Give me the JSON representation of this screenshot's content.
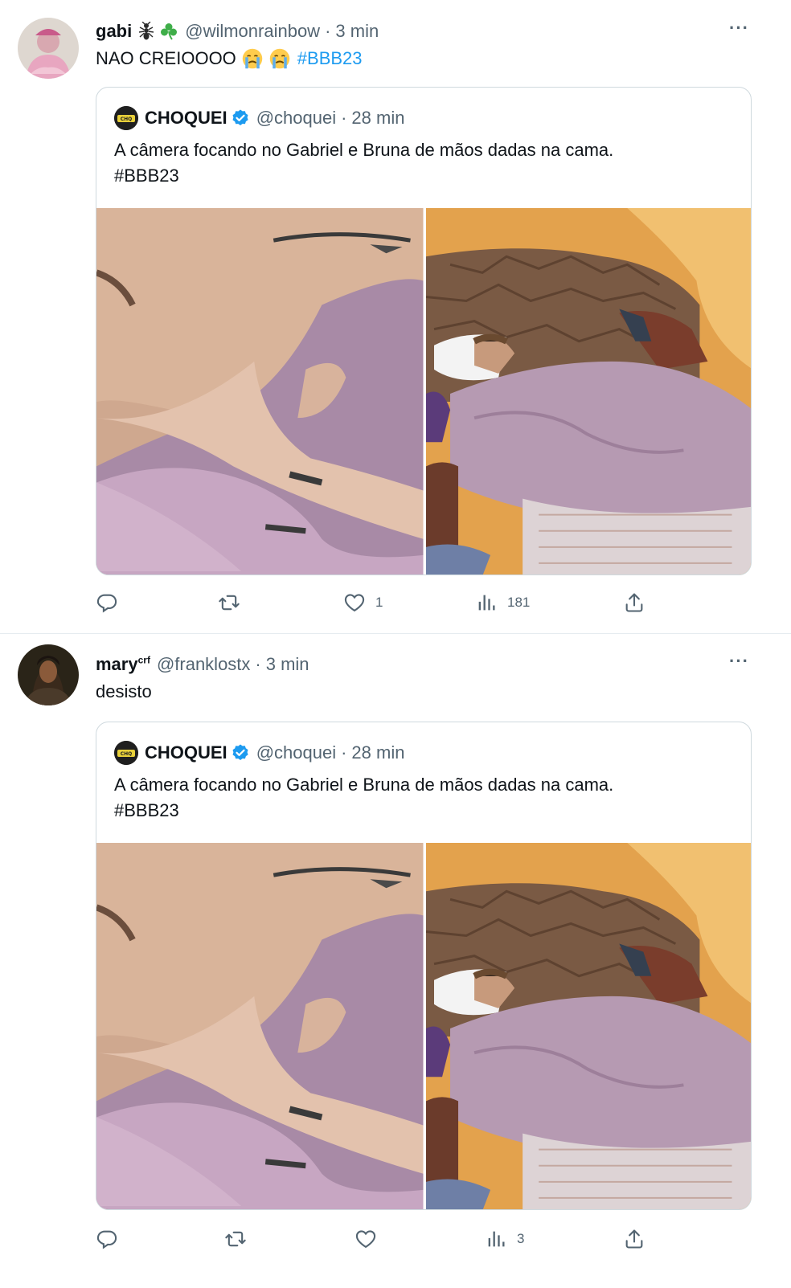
{
  "tweets": [
    {
      "display_name": "gabi",
      "name_emojis": [
        "ant-icon",
        "shamrock-icon"
      ],
      "handle": "@wilmonrainbow",
      "dot": "·",
      "time": "3 min",
      "more": "···",
      "text": "NAO CREIOOOO",
      "text_emojis": [
        "crying-emoji",
        "crying-emoji"
      ],
      "hashtag": "#BBB23",
      "quote": {
        "name": "CHOQUEI",
        "handle": "@choquei",
        "dot": "·",
        "time": "28 min",
        "text_line1": "A câmera focando no Gabriel e Bruna de mãos dadas na cama.",
        "text_line2": "#BBB23"
      },
      "actions": {
        "reply": "",
        "retweet": "",
        "like": "1",
        "views": "181",
        "share": ""
      }
    },
    {
      "display_name": "mary",
      "name_sup": "crf",
      "handle": "@franklostx",
      "dot": "·",
      "time": "3 min",
      "more": "···",
      "text": "desisto",
      "quote": {
        "name": "CHOQUEI",
        "handle": "@choquei",
        "dot": "·",
        "time": "28 min",
        "text_line1": "A câmera focando no Gabriel e Bruna de mãos dadas na cama.",
        "text_line2": "#BBB23"
      },
      "actions": {
        "reply": "",
        "retweet": "",
        "like": "",
        "views": "3",
        "share": ""
      }
    }
  ],
  "colors": {
    "link": "#1d9bf0",
    "secondary_text": "#536471",
    "border": "#cfd9de",
    "verified": "#1d9bf0"
  }
}
